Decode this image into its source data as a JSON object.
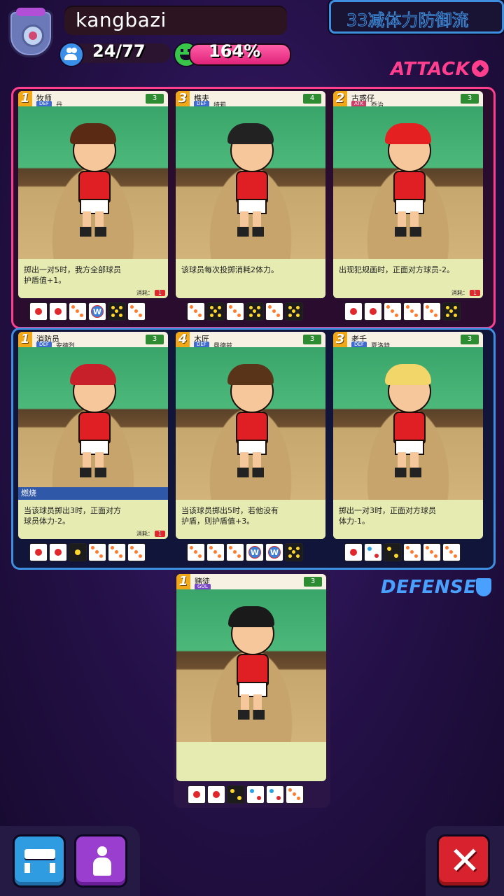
{
  "header": {
    "username": "kangbazi",
    "players": "24/77",
    "mood": "164%",
    "mood_fill": 1.0,
    "formation": "33减体力防御流"
  },
  "labels": {
    "attack": "ATTACK",
    "defense": "DEFENSE"
  },
  "colors": {
    "attack": "#ff3f8e",
    "defense": "#3f8fe0"
  },
  "attack_cards": [
    {
      "cost": "1",
      "name": "牧师",
      "position": "DEF",
      "player": "丹",
      "hp": "3",
      "tag": "",
      "desc_line1": "掷出一对5时，我方全部球员",
      "desc_line2": "护盾值+1。",
      "consume_label": "消耗：",
      "consume": "1",
      "dice": [
        "red",
        "red",
        "three",
        "w",
        "black4",
        "three"
      ],
      "hair": "#5a2a14"
    },
    {
      "cost": "3",
      "name": "樵夫",
      "position": "DEF",
      "player": "绮莉",
      "hp": "4",
      "tag": "",
      "desc_line1": "该球员每次投掷消耗2体力。",
      "desc_line2": "",
      "consume_label": "",
      "consume": "",
      "dice": [
        "three",
        "black4",
        "three",
        "black4",
        "three",
        "black4"
      ],
      "hair": "#222222"
    },
    {
      "cost": "2",
      "name": "古惑仔",
      "position": "ATK",
      "player": "乔治",
      "hp": "3",
      "tag": "",
      "desc_line1": "出现犯规画时，正面对方球员-2。",
      "desc_line2": "",
      "consume_label": "消耗：",
      "consume": "1",
      "dice": [
        "red",
        "red",
        "three",
        "three",
        "three",
        "black4"
      ],
      "hair": "#e42020"
    }
  ],
  "defense_cards": [
    {
      "cost": "1",
      "name": "消防员",
      "position": "DEF",
      "player": "安德烈",
      "hp": "3",
      "tag": "燃烧",
      "desc_line1": "当该球员掷出3时，正面对方",
      "desc_line2": "球员体力-2。",
      "consume_label": "消耗：",
      "consume": "1",
      "dice": [
        "red",
        "red",
        "yellow",
        "three",
        "three",
        "three"
      ],
      "hair": "#c8202a"
    },
    {
      "cost": "4",
      "name": "木匠",
      "position": "DEF",
      "player": "曼德兹",
      "hp": "3",
      "tag": "",
      "desc_line1": "当该球员掷出5时，若他没有",
      "desc_line2": "护盾，则护盾值+3。",
      "consume_label": "",
      "consume": "",
      "dice": [
        "three",
        "three",
        "three",
        "w",
        "w",
        "black4"
      ],
      "hair": "#5a3418"
    },
    {
      "cost": "3",
      "name": "老千",
      "position": "DEF",
      "player": "夏洛特",
      "hp": "3",
      "tag": "",
      "desc_line1": "掷出一对3时，正面对方球员",
      "desc_line2": "体力-1。",
      "consume_label": "",
      "consume": "",
      "dice": [
        "red",
        "blue",
        "black2",
        "three",
        "three",
        "three"
      ],
      "hair": "#f3d66a"
    }
  ],
  "bench_card": {
    "cost": "1",
    "name": "赌徒",
    "position": "GOL",
    "player": "",
    "hp": "3",
    "dice": [
      "red",
      "red",
      "black2",
      "blue",
      "blue",
      "three"
    ],
    "hair": "#1a1a1a"
  },
  "buttons": {
    "bench": "bench-icon",
    "player": "player-icon",
    "close": "close-icon"
  }
}
